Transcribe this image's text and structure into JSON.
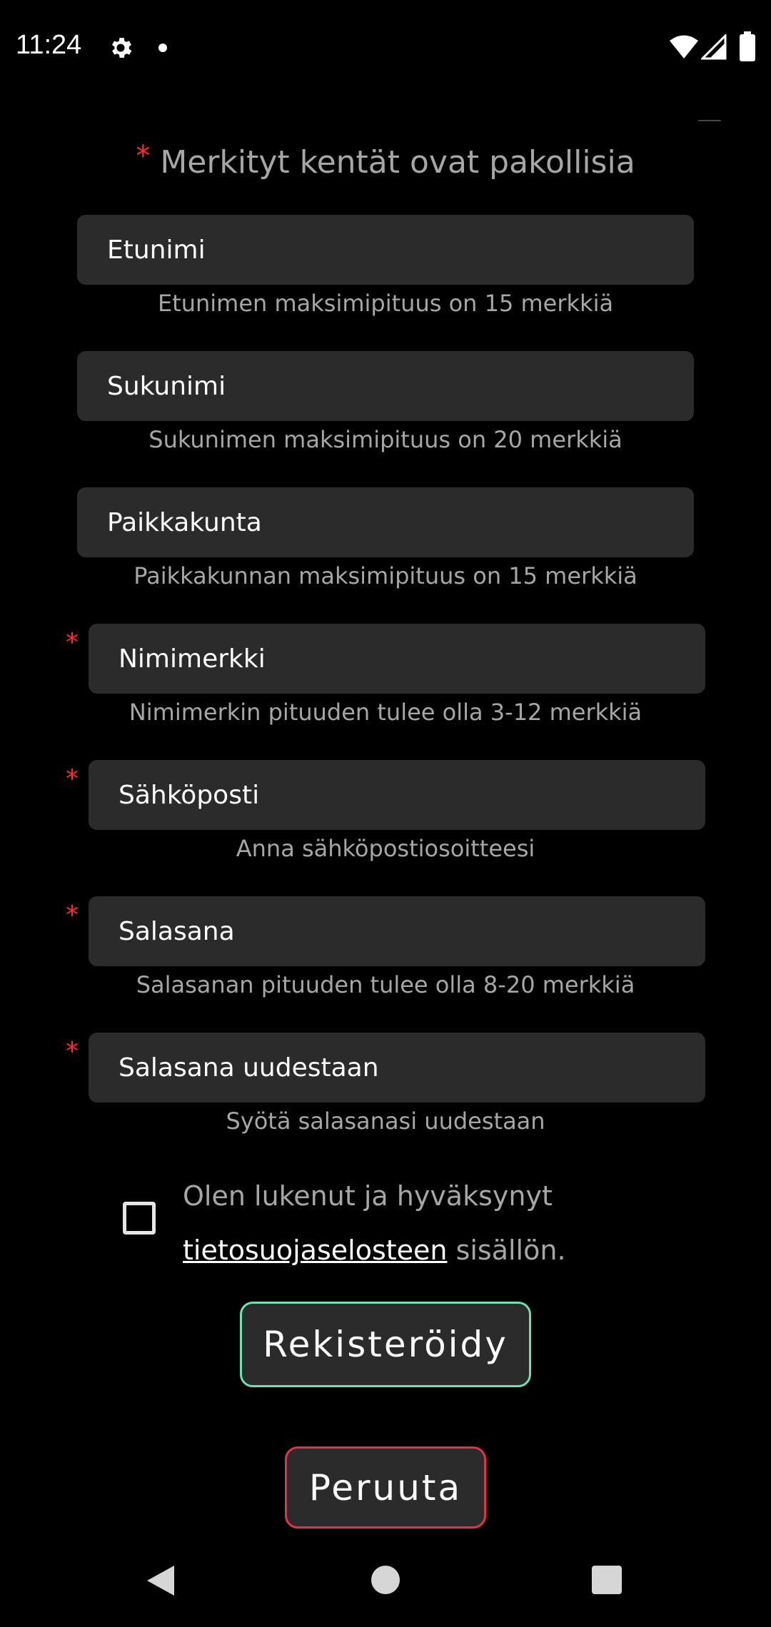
{
  "status_bar": {
    "time": "11:24",
    "icons": [
      "gear-icon",
      "notification-dot-icon",
      "wifi-icon",
      "signal-icon",
      "battery-icon"
    ]
  },
  "form": {
    "required_star": "*",
    "required_note": "Merkityt kentät ovat pakollisia",
    "fields": [
      {
        "placeholder": "Etunimi",
        "hint": "Etunimen maksimipituus on 15 merkkiä",
        "required": false
      },
      {
        "placeholder": "Sukunimi",
        "hint": "Sukunimen maksimipituus on 20 merkkiä",
        "required": false
      },
      {
        "placeholder": "Paikkakunta",
        "hint": "Paikkakunnan maksimipituus on 15 merkkiä",
        "required": false
      },
      {
        "placeholder": "Nimimerkki",
        "hint": "Nimimerkin pituuden tulee olla 3-12 merkkiä",
        "required": true
      },
      {
        "placeholder": "Sähköposti",
        "hint": "Anna sähköpostiosoitteesi",
        "required": true
      },
      {
        "placeholder": "Salasana",
        "hint": "Salasanan pituuden tulee olla 8-20 merkkiä",
        "required": true
      },
      {
        "placeholder": "Salasana uudestaan",
        "hint": "Syötä salasanasi uudestaan",
        "required": true
      }
    ],
    "consent": {
      "checked": false,
      "line1": "Olen lukenut ja hyväksynyt",
      "link": "tietosuojaselosteen",
      "line2_rest": " sisällön."
    },
    "register_label": "Rekisteröidy",
    "cancel_label": "Peruuta"
  },
  "colors": {
    "background": "#000000",
    "field": "#2b2b2b",
    "hint_text": "#a6a6a6",
    "required_star": "#ff2a2a",
    "register_border": "#6fe0b0",
    "cancel_border": "#e8304a"
  },
  "nav_bar": {
    "icons": [
      "back-icon",
      "home-icon",
      "recent-apps-icon"
    ]
  }
}
